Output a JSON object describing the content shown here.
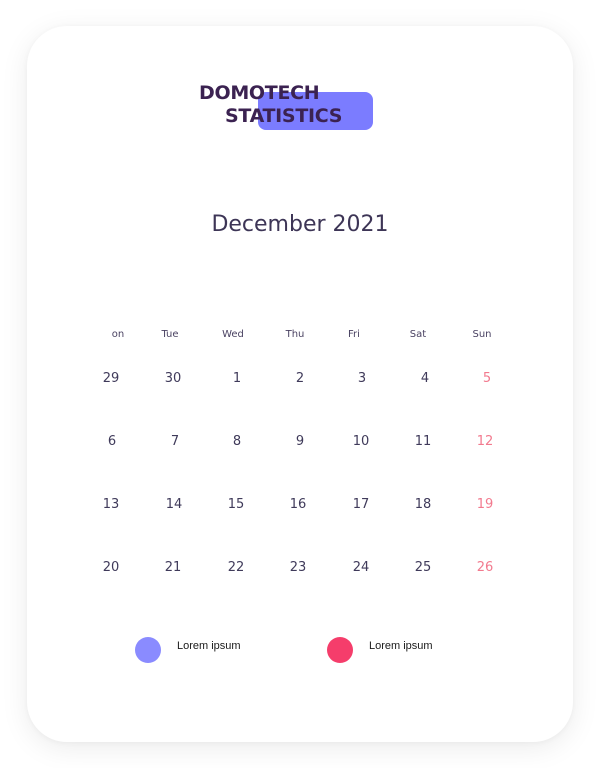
{
  "logo": {
    "line1": "DOMOTECH",
    "line2": "STATISTICS"
  },
  "calendar": {
    "title": "December 2021",
    "weekdays": [
      "on",
      "Tue",
      "Wed",
      "Thu",
      "Fri",
      "Sat",
      "Sun"
    ],
    "weeks": [
      [
        "29",
        "30",
        "1",
        "2",
        "3",
        "4",
        "5"
      ],
      [
        "6",
        "7",
        "8",
        "9",
        "10",
        "11",
        "12"
      ],
      [
        "13",
        "14",
        "15",
        "16",
        "17",
        "18",
        "19"
      ],
      [
        "20",
        "21",
        "22",
        "23",
        "24",
        "25",
        "26"
      ]
    ]
  },
  "legend": [
    {
      "label": "Lorem ipsum",
      "color": "#8a8bff"
    },
    {
      "label": "Lorem ipsum",
      "color": "#f53d6b"
    }
  ],
  "colors": {
    "accent": "#7b7cff",
    "weekend": "#f27a8e",
    "text": "#3f3a5a"
  }
}
